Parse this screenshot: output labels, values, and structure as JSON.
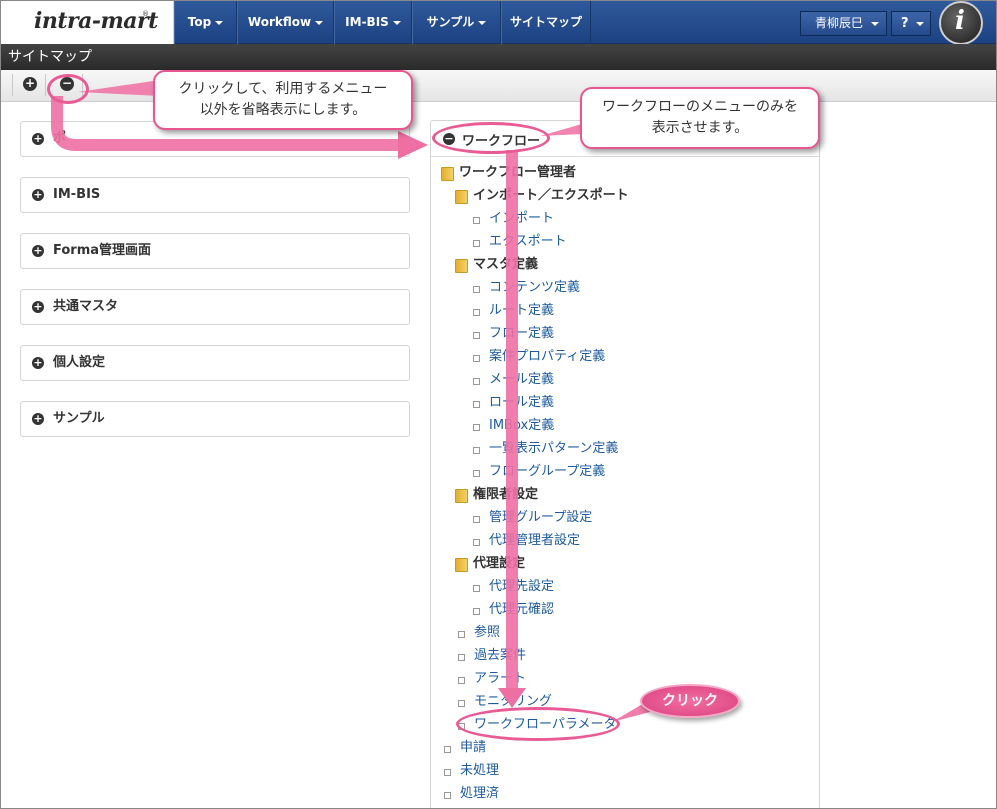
{
  "header": {
    "logo_text": "intra-mart",
    "logo_reg": "®",
    "nav": [
      {
        "label": "Top"
      },
      {
        "label": "Workflow"
      },
      {
        "label": "IM-BIS"
      },
      {
        "label": "サンプル"
      },
      {
        "label": "サイトマップ"
      }
    ],
    "user_name": "青柳辰巳",
    "help_label": "?",
    "brand_icon_text": "i"
  },
  "page_title": "サイトマップ",
  "toolbar": {
    "expand_glyph": "+",
    "collapse_glyph": "−"
  },
  "left_panels": [
    {
      "label": "ポ"
    },
    {
      "label": "IM-BIS"
    },
    {
      "label": "Forma管理画面"
    },
    {
      "label": "共通マスタ"
    },
    {
      "label": "個人設定"
    },
    {
      "label": "サンプル"
    }
  ],
  "workflow_panel": {
    "title": "ワークフロー",
    "tree": {
      "root": "ワークフロー管理者",
      "g1": "インポート／エクスポート",
      "g1_items": [
        "インポート",
        "エクスポート"
      ],
      "g2": "マスタ定義",
      "g2_items": [
        "コンテンツ定義",
        "ルート定義",
        "フロー定義",
        "案件プロパティ定義",
        "メール定義",
        "ロール定義",
        "IMBox定義",
        "一覧表示パターン定義",
        "フローグループ定義"
      ],
      "g3": "権限者設定",
      "g3_items": [
        "管理グループ設定",
        "代理管理者設定"
      ],
      "g4": "代理設定",
      "g4_items": [
        "代理先設定",
        "代理元確認"
      ],
      "direct": [
        "参照",
        "過去案件",
        "アラート",
        "モニタリング",
        "ワークフローパラメータ"
      ],
      "top": [
        "申請",
        "未処理",
        "処理済"
      ]
    }
  },
  "annotations": {
    "callout_collapse": "クリックして、利用するメニュー\n以外を省略表示にします。",
    "callout_workflow": "ワークフローのメニューのみを\n表示させます。",
    "click_label": "クリック"
  },
  "colors": {
    "nav_blue": "#1d4282",
    "accent_pink": "#e9558f",
    "link_blue": "#1d5a9e"
  }
}
